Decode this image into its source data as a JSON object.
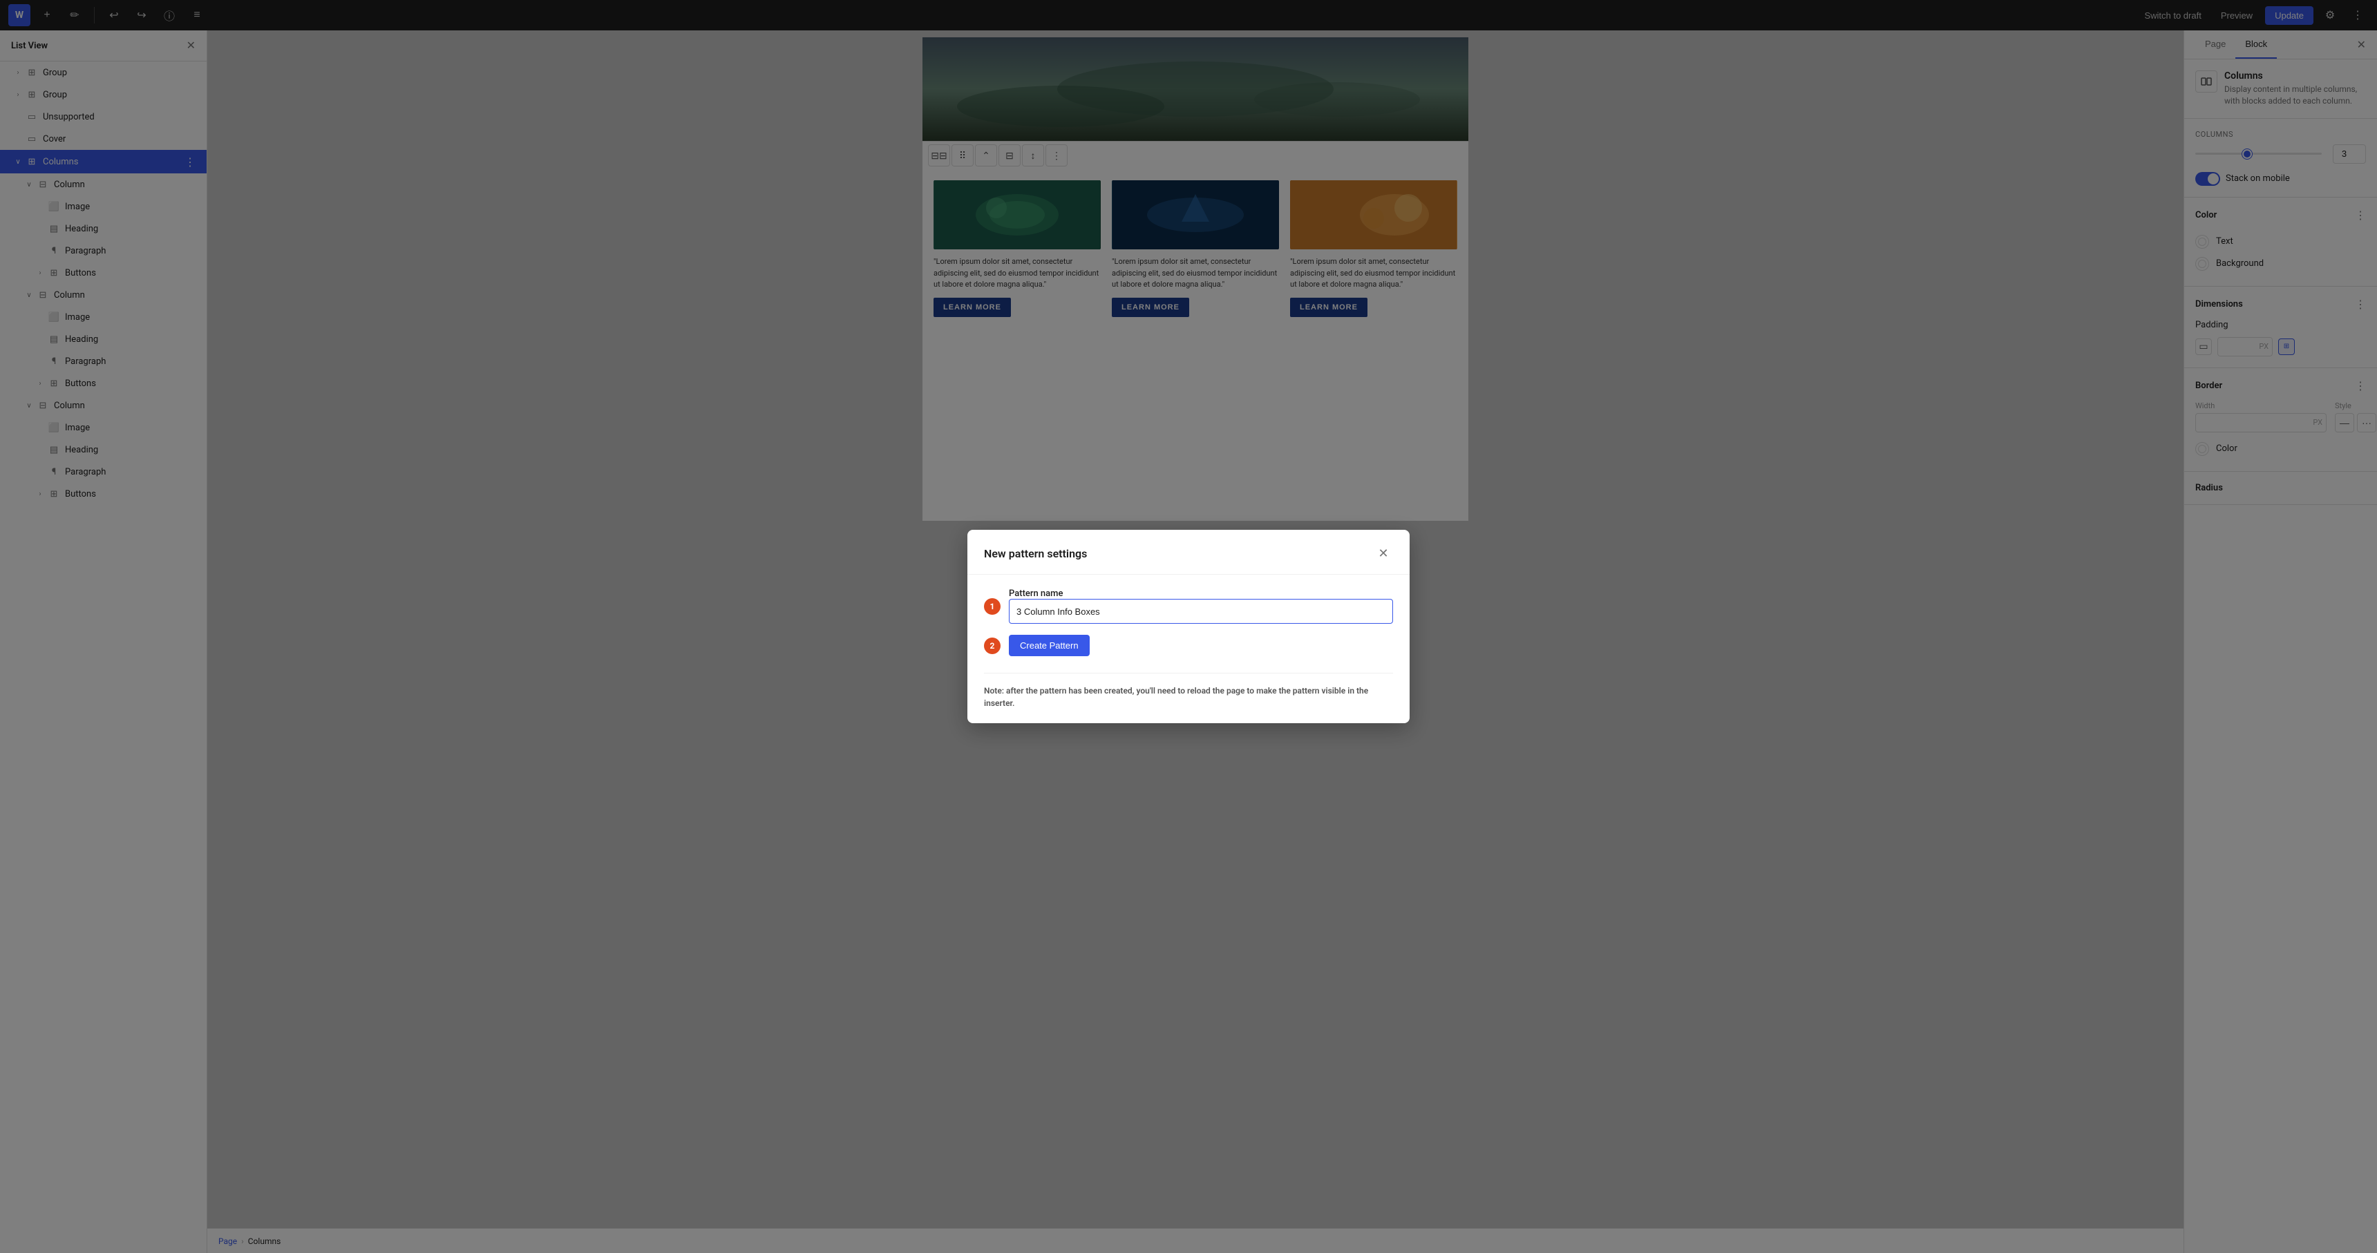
{
  "topbar": {
    "logo": "W",
    "switch_to_draft": "Switch to draft",
    "preview": "Preview",
    "update": "Update"
  },
  "sidebar": {
    "title": "List View",
    "items": [
      {
        "id": "group1",
        "label": "Group",
        "indent": 0,
        "has_chevron": true,
        "icon": "⊞"
      },
      {
        "id": "group2",
        "label": "Group",
        "indent": 0,
        "has_chevron": true,
        "icon": "⊞"
      },
      {
        "id": "unsupported",
        "label": "Unsupported",
        "indent": 0,
        "has_chevron": false,
        "icon": "▭"
      },
      {
        "id": "cover",
        "label": "Cover",
        "indent": 0,
        "has_chevron": false,
        "icon": "▭"
      },
      {
        "id": "columns",
        "label": "Columns",
        "indent": 0,
        "active": true,
        "has_chevron": true,
        "icon": "⊞"
      },
      {
        "id": "column1",
        "label": "Column",
        "indent": 1,
        "has_chevron": true,
        "icon": "⊟"
      },
      {
        "id": "image1",
        "label": "Image",
        "indent": 2,
        "has_chevron": false,
        "icon": "⬜"
      },
      {
        "id": "heading1",
        "label": "Heading",
        "indent": 2,
        "has_chevron": false,
        "icon": "▤"
      },
      {
        "id": "paragraph1",
        "label": "Paragraph",
        "indent": 2,
        "has_chevron": false,
        "icon": "¶"
      },
      {
        "id": "buttons1",
        "label": "Buttons",
        "indent": 2,
        "has_chevron": true,
        "icon": "⊞"
      },
      {
        "id": "column2",
        "label": "Column",
        "indent": 1,
        "has_chevron": true,
        "icon": "⊟"
      },
      {
        "id": "image2",
        "label": "Image",
        "indent": 2,
        "has_chevron": false,
        "icon": "⬜"
      },
      {
        "id": "heading2",
        "label": "Heading",
        "indent": 2,
        "has_chevron": false,
        "icon": "▤"
      },
      {
        "id": "paragraph2",
        "label": "Paragraph",
        "indent": 2,
        "has_chevron": false,
        "icon": "¶"
      },
      {
        "id": "buttons2",
        "label": "Buttons",
        "indent": 2,
        "has_chevron": true,
        "icon": "⊞"
      },
      {
        "id": "column3",
        "label": "Column",
        "indent": 1,
        "has_chevron": true,
        "icon": "⊟"
      },
      {
        "id": "image3",
        "label": "Image",
        "indent": 2,
        "has_chevron": false,
        "icon": "⬜"
      },
      {
        "id": "heading3",
        "label": "Heading",
        "indent": 2,
        "has_chevron": false,
        "icon": "▤"
      },
      {
        "id": "paragraph3",
        "label": "Paragraph",
        "indent": 2,
        "has_chevron": false,
        "icon": "¶"
      },
      {
        "id": "buttons3",
        "label": "Buttons",
        "indent": 2,
        "has_chevron": true,
        "icon": "⊞"
      }
    ]
  },
  "right_panel": {
    "tab_page": "Page",
    "tab_block": "Block",
    "block_name": "Columns",
    "block_desc": "Display content in multiple columns, with blocks added to each column.",
    "columns_label": "Columns",
    "columns_value": "3",
    "stack_on_mobile_label": "Stack on mobile",
    "color_label": "Color",
    "text_label": "Text",
    "background_label": "Background",
    "dimensions_label": "Dimensions",
    "padding_label": "Padding",
    "border_label": "Border",
    "border_width_label": "Width",
    "border_style_label": "Style",
    "border_color_label": "Color",
    "radius_label": "Radius"
  },
  "modal": {
    "title": "New pattern settings",
    "field_label": "Pattern name",
    "field_value": "3 Column Info Boxes",
    "button_label": "Create Pattern",
    "note": "Note: after the pattern has been created, you'll need to reload the page to make the pattern visible in the inserter."
  },
  "breadcrumb": {
    "page": "Page",
    "separator": "›",
    "current": "Columns"
  },
  "canvas": {
    "learn_more": "LEARN MORE",
    "col_text": "\"Lorem ipsum dolor sit amet, consectetur adipiscing elit, sed do eiusmod tempor incididunt ut labore et dolore magna aliqua.\""
  }
}
